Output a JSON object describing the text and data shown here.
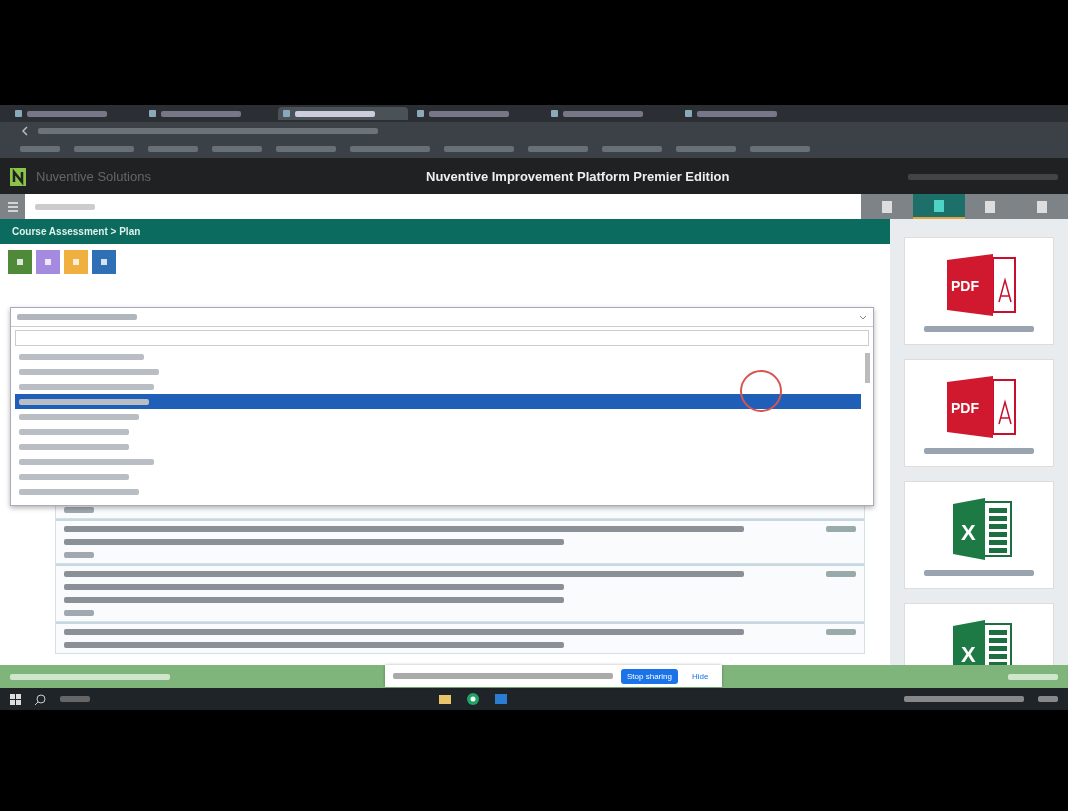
{
  "browser_tabs": [
    {
      "selected": false
    },
    {
      "selected": false
    },
    {
      "selected": true
    },
    {
      "selected": false
    },
    {
      "selected": false
    },
    {
      "selected": false
    }
  ],
  "app": {
    "brand": "Nuventive Solutions",
    "title": "Nuventive Improvement Platform Premier Edition"
  },
  "breadcrumb": "Course Assessment > Plan",
  "header_tiles": [
    {
      "selected": false
    },
    {
      "selected": true
    },
    {
      "selected": false
    },
    {
      "selected": false
    }
  ],
  "action_buttons": [
    {
      "color": "#4e8a3a"
    },
    {
      "color": "#a58be0"
    },
    {
      "color": "#f0b040"
    },
    {
      "color": "#2f6fb5"
    }
  ],
  "dropdown_items": [
    {
      "selected": false
    },
    {
      "selected": false
    },
    {
      "selected": false
    },
    {
      "selected": true
    },
    {
      "selected": false
    },
    {
      "selected": false
    },
    {
      "selected": false
    },
    {
      "selected": false
    },
    {
      "selected": false
    },
    {
      "selected": false
    }
  ],
  "files": [
    {
      "kind": "pdf",
      "icon_text": "PDF"
    },
    {
      "kind": "pdf",
      "icon_text": "PDF"
    },
    {
      "kind": "excel",
      "icon_text": "X"
    },
    {
      "kind": "excel",
      "icon_text": "X"
    }
  ],
  "share_bar": {
    "buttons": [
      "Stop sharing",
      "Hide"
    ]
  }
}
